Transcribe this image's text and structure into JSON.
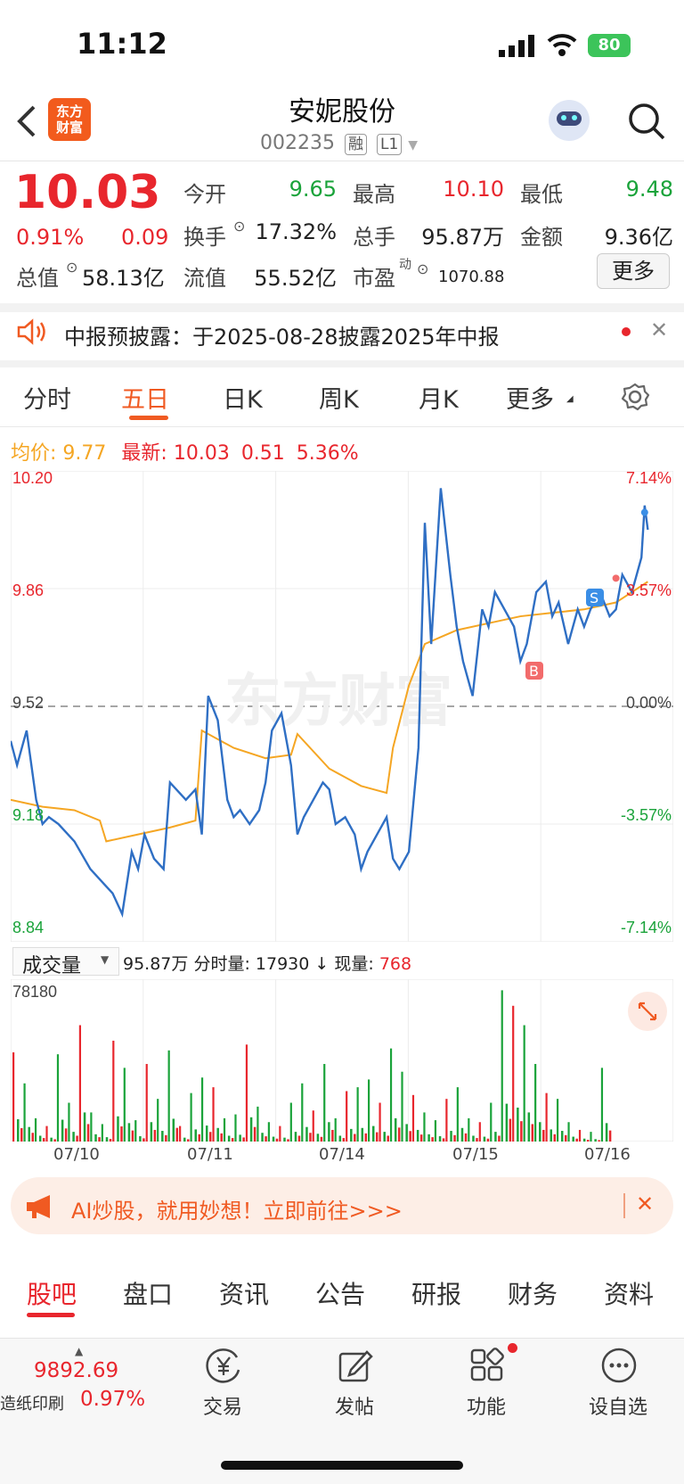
{
  "status": {
    "time": "11:12",
    "battery": "80"
  },
  "header": {
    "logo_line1": "东方",
    "logo_line2": "财富",
    "name": "安妮股份",
    "code": "002235",
    "tag1": "融",
    "tag2": "L1"
  },
  "quote": {
    "price": "10.03",
    "change_pct": "0.91%",
    "change": "0.09",
    "open_label": "今开",
    "open": "9.65",
    "high_label": "最高",
    "high": "10.10",
    "low_label": "最低",
    "low": "9.48",
    "turnover_label": "换手",
    "turnover": "17.32%",
    "volume_label": "总手",
    "volume": "95.87万",
    "amount_label": "金额",
    "amount": "9.36亿",
    "mktcap_label": "总值",
    "mktcap": "58.13亿",
    "float_label": "流值",
    "float": "55.52亿",
    "pe_label": "市盈",
    "pe_sup": "动",
    "pe": "1070.88",
    "more": "更多"
  },
  "notice": {
    "text": "中报预披露：于2025-08-28披露2025年中报"
  },
  "tabs": [
    "分时",
    "五日",
    "日K",
    "周K",
    "月K",
    "更多"
  ],
  "legend": {
    "avg_label": "均价:",
    "avg": "9.77",
    "latest_label": "最新:",
    "latest": "10.03",
    "chg": "0.51",
    "pct": "5.36%"
  },
  "chart_data": [
    {
      "type": "line",
      "y_left_ticks": [
        "10.20",
        "9.86",
        "9.52",
        "9.18",
        "8.84"
      ],
      "y_right_ticks": [
        "7.14%",
        "3.57%",
        "0.00%",
        "-3.57%",
        "-7.14%"
      ],
      "x_labels": [
        "07/10",
        "07/11",
        "07/14",
        "07/15",
        "07/16"
      ],
      "ylim": [
        8.84,
        10.2
      ],
      "reference": 9.52,
      "series": [
        {
          "color": "#2f6fc4",
          "x": [
            0,
            2,
            5,
            8,
            10,
            12,
            15,
            18,
            20,
            25,
            30,
            32,
            35,
            38,
            40,
            42,
            45,
            48,
            50,
            55,
            58,
            60,
            62,
            65,
            68,
            70,
            72,
            75,
            78,
            80,
            82,
            85,
            88,
            90,
            92,
            95,
            98,
            100,
            102,
            105,
            108,
            110,
            112,
            115,
            118,
            120,
            122,
            125,
            128,
            130,
            132,
            135,
            138,
            140,
            142,
            145,
            148,
            150,
            152,
            155,
            158,
            160,
            162,
            165,
            168,
            170,
            172,
            175,
            178,
            180,
            182,
            185,
            188,
            190,
            192,
            195,
            198,
            199,
            200
          ],
          "y": [
            9.42,
            9.35,
            9.45,
            9.25,
            9.18,
            9.2,
            9.18,
            9.15,
            9.13,
            9.05,
            9.0,
            8.98,
            8.92,
            9.1,
            9.05,
            9.15,
            9.08,
            9.05,
            9.3,
            9.25,
            9.28,
            9.15,
            9.55,
            9.48,
            9.25,
            9.2,
            9.22,
            9.18,
            9.22,
            9.3,
            9.45,
            9.5,
            9.35,
            9.15,
            9.2,
            9.25,
            9.3,
            9.28,
            9.18,
            9.2,
            9.15,
            9.05,
            9.1,
            9.15,
            9.2,
            9.08,
            9.05,
            9.1,
            9.4,
            10.05,
            9.7,
            10.15,
            9.9,
            9.75,
            9.65,
            9.55,
            9.8,
            9.75,
            9.85,
            9.8,
            9.75,
            9.65,
            9.7,
            9.85,
            9.88,
            9.78,
            9.82,
            9.7,
            9.8,
            9.75,
            9.8,
            9.85,
            9.78,
            9.8,
            9.9,
            9.85,
            9.95,
            10.1,
            10.03
          ]
        },
        {
          "color": "#f5a623",
          "x": [
            0,
            10,
            20,
            28,
            30,
            40,
            50,
            58,
            60,
            70,
            80,
            88,
            90,
            100,
            110,
            118,
            120,
            125,
            130,
            135,
            140,
            150,
            160,
            170,
            180,
            190,
            200
          ],
          "y": [
            9.25,
            9.23,
            9.22,
            9.19,
            9.13,
            9.15,
            9.17,
            9.19,
            9.45,
            9.4,
            9.37,
            9.38,
            9.44,
            9.34,
            9.29,
            9.27,
            9.4,
            9.58,
            9.7,
            9.72,
            9.74,
            9.76,
            9.78,
            9.79,
            9.8,
            9.82,
            9.88
          ]
        }
      ]
    },
    {
      "type": "bar",
      "ylim": [
        0,
        78180
      ],
      "top_label": "78180",
      "values": [
        46000,
        30000,
        12000,
        8000,
        45000,
        20000,
        60000,
        15000,
        9000,
        52000,
        38000,
        11000,
        40000,
        22000,
        47000,
        8000,
        25000,
        33000,
        28000,
        12000,
        14000,
        50000,
        18000,
        10000,
        8000,
        20000,
        30000,
        16000,
        40000,
        12000,
        26000,
        28000,
        32000,
        20000,
        48000,
        36000,
        24000,
        15000,
        11000,
        22000,
        28000,
        12000,
        10000,
        20000,
        78000,
        70000,
        60000,
        40000,
        25000,
        22000,
        10000,
        6000,
        5000,
        38000
      ]
    }
  ],
  "volume_bar": {
    "selector": "成交量",
    "total": "95.87万",
    "min_label": "分时量:",
    "min_val": "17930",
    "arrow": "↓",
    "now_label": "现量:",
    "now_val": "768"
  },
  "banner": {
    "text": "AI炒股，就用妙想！立即前往>>>"
  },
  "bottom_tabs": [
    "股吧",
    "盘口",
    "资讯",
    "公告",
    "研报",
    "财务",
    "资料"
  ],
  "bottom_nav": {
    "index_value": "9892.69",
    "index_name": "造纸印刷",
    "index_pct": "0.97%",
    "items": [
      {
        "label": "交易",
        "icon": "yen-circle-icon"
      },
      {
        "label": "发帖",
        "icon": "edit-icon"
      },
      {
        "label": "功能",
        "icon": "grid-icon"
      },
      {
        "label": "设自选",
        "icon": "more-circle-icon"
      }
    ]
  }
}
